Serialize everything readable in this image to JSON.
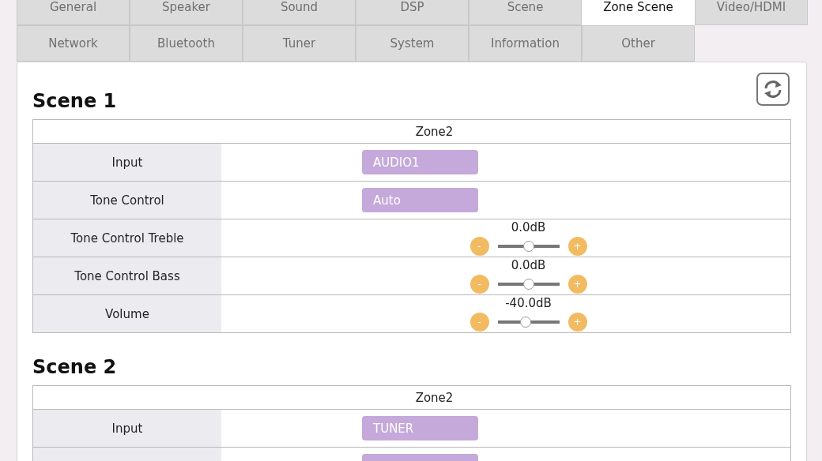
{
  "tabs": [
    {
      "label": "General",
      "selected": false
    },
    {
      "label": "Speaker",
      "selected": false
    },
    {
      "label": "Sound",
      "selected": false
    },
    {
      "label": "DSP",
      "selected": false
    },
    {
      "label": "Scene",
      "selected": false
    },
    {
      "label": "Zone Scene",
      "selected": true
    },
    {
      "label": "Video/HDMI",
      "selected": false
    },
    {
      "label": "Network",
      "selected": false
    },
    {
      "label": "Bluetooth",
      "selected": false
    },
    {
      "label": "Tuner",
      "selected": false
    },
    {
      "label": "System",
      "selected": false
    },
    {
      "label": "Information",
      "selected": false
    },
    {
      "label": "Other",
      "selected": false
    }
  ],
  "scenes": [
    {
      "title": "Scene 1",
      "zone": "Zone2",
      "rows": [
        {
          "kind": "select",
          "label": "Input",
          "value": "AUDIO1"
        },
        {
          "kind": "select",
          "label": "Tone Control",
          "value": "Auto"
        },
        {
          "kind": "slider",
          "label": "Tone Control Treble",
          "reading": "0.0dB",
          "level": 0.5,
          "minus": "-",
          "plus": "+"
        },
        {
          "kind": "slider",
          "label": "Tone Control Bass",
          "reading": "0.0dB",
          "level": 0.5,
          "minus": "-",
          "plus": "+"
        },
        {
          "kind": "slider",
          "label": "Volume",
          "reading": "-40.0dB",
          "level": 0.45,
          "minus": "-",
          "plus": "+"
        }
      ]
    },
    {
      "title": "Scene 2",
      "zone": "Zone2",
      "rows": [
        {
          "kind": "select",
          "label": "Input",
          "value": "TUNER"
        },
        {
          "kind": "select"
        }
      ]
    }
  ]
}
